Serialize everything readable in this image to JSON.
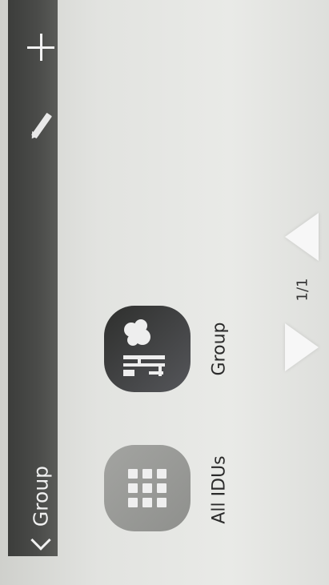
{
  "header": {
    "title": "Group",
    "icons": [
      "back-icon",
      "edit-icon",
      "plus-icon"
    ]
  },
  "tiles": [
    {
      "label": "All IDUs",
      "icon": "grid-icon"
    },
    {
      "label": "Group",
      "icon": "group-icon"
    }
  ],
  "pager": {
    "text": "1/1",
    "icons": [
      "previous-page-arrow",
      "next-page-arrow"
    ]
  },
  "colors": {
    "header_bg": "#444543",
    "tile_all_bg": "#9a9b98",
    "tile_group_bg": "#3a3b39",
    "background": "#e4e5e2"
  }
}
